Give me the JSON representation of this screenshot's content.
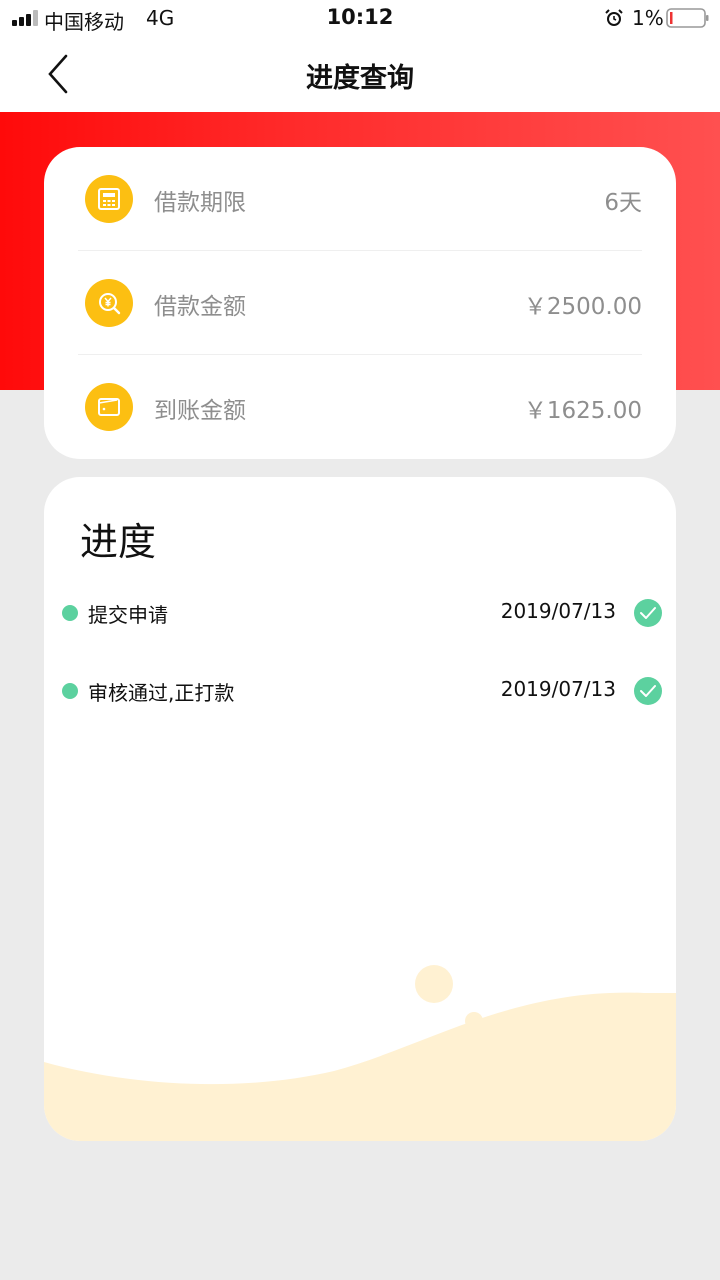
{
  "status_bar": {
    "carrier": "中国移动",
    "network": "4G",
    "time": "10:12",
    "battery": "1%"
  },
  "nav": {
    "title": "进度查询"
  },
  "loan": {
    "rows": [
      {
        "label": "借款期限",
        "value": "6天",
        "icon": "calculator-icon"
      },
      {
        "label": "借款金额",
        "value": "￥2500.00",
        "icon": "yuan-search-icon"
      },
      {
        "label": "到账金额",
        "value": "￥1625.00",
        "icon": "wallet-icon"
      }
    ]
  },
  "progress": {
    "title": "进度",
    "steps": [
      {
        "label": "提交申请",
        "date": "2019/07/13",
        "done": true
      },
      {
        "label": "审核通过,正打款",
        "date": "2019/07/13",
        "done": true
      }
    ]
  },
  "colors": {
    "brand_red": "#ff1a1a",
    "icon_yellow": "#fcbf12",
    "success_green": "#5cd19f",
    "wave_cream": "#fff1d2"
  }
}
